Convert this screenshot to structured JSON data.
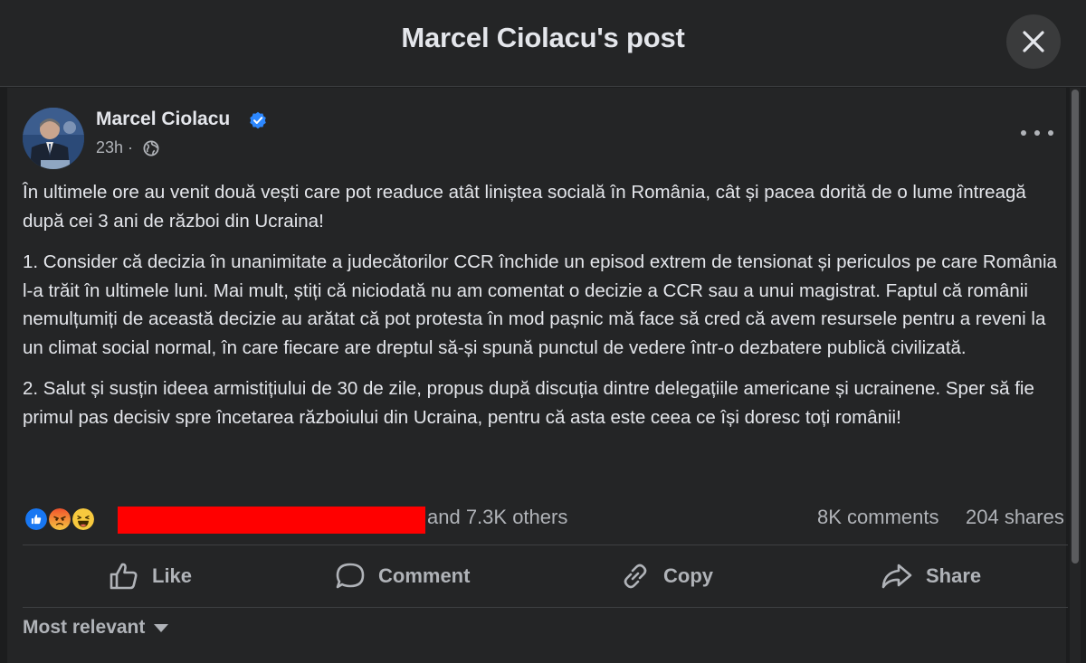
{
  "modal": {
    "title": "Marcel Ciolacu's post"
  },
  "post": {
    "author": "Marcel Ciolacu",
    "verified": true,
    "time": "23h",
    "paragraphs": [
      "În ultimele ore au venit două vești care pot readuce atât liniștea socială în România, cât și pacea dorită de o lume întreagă după cei 3 ani de război din Ucraina!",
      "1. Consider că decizia în unanimitate a judecătorilor CCR închide un episod extrem de tensionat și periculos pe care România l-a trăit în ultimele luni. Mai mult, știți că niciodată nu am comentat o decizie a CCR sau a unui magistrat. Faptul că românii nemulțumiți de această decizie au arătat că pot protesta în mod pașnic mă face să cred că avem resursele pentru a reveni la un climat social normal, în care fiecare are dreptul să-și spună punctul de vedere într-o dezbatere publică civilizată.",
      "2. Salut și susțin ideea armistițiului de 30 de zile, propus după discuția dintre delegațiile americane și ucrainene. Sper să fie primul pas decisiv spre încetarea războiului din Ucraina, pentru că asta este ceea ce își doresc toți românii!"
    ]
  },
  "reactions": {
    "icons": [
      "like-reaction-icon",
      "angry-reaction-icon",
      "haha-reaction-icon"
    ],
    "others_text": "and 7.3K others",
    "comments_text": "8K comments",
    "shares_text": "204 shares"
  },
  "actions": {
    "like": "Like",
    "comment": "Comment",
    "copy": "Copy",
    "share": "Share"
  },
  "comments": {
    "sort_label": "Most relevant"
  },
  "colors": {
    "background": "#242526",
    "text": "#e4e6eb",
    "secondary": "#b0b3b8",
    "verified": "#2d88ff",
    "redaction": "#ff0000"
  }
}
